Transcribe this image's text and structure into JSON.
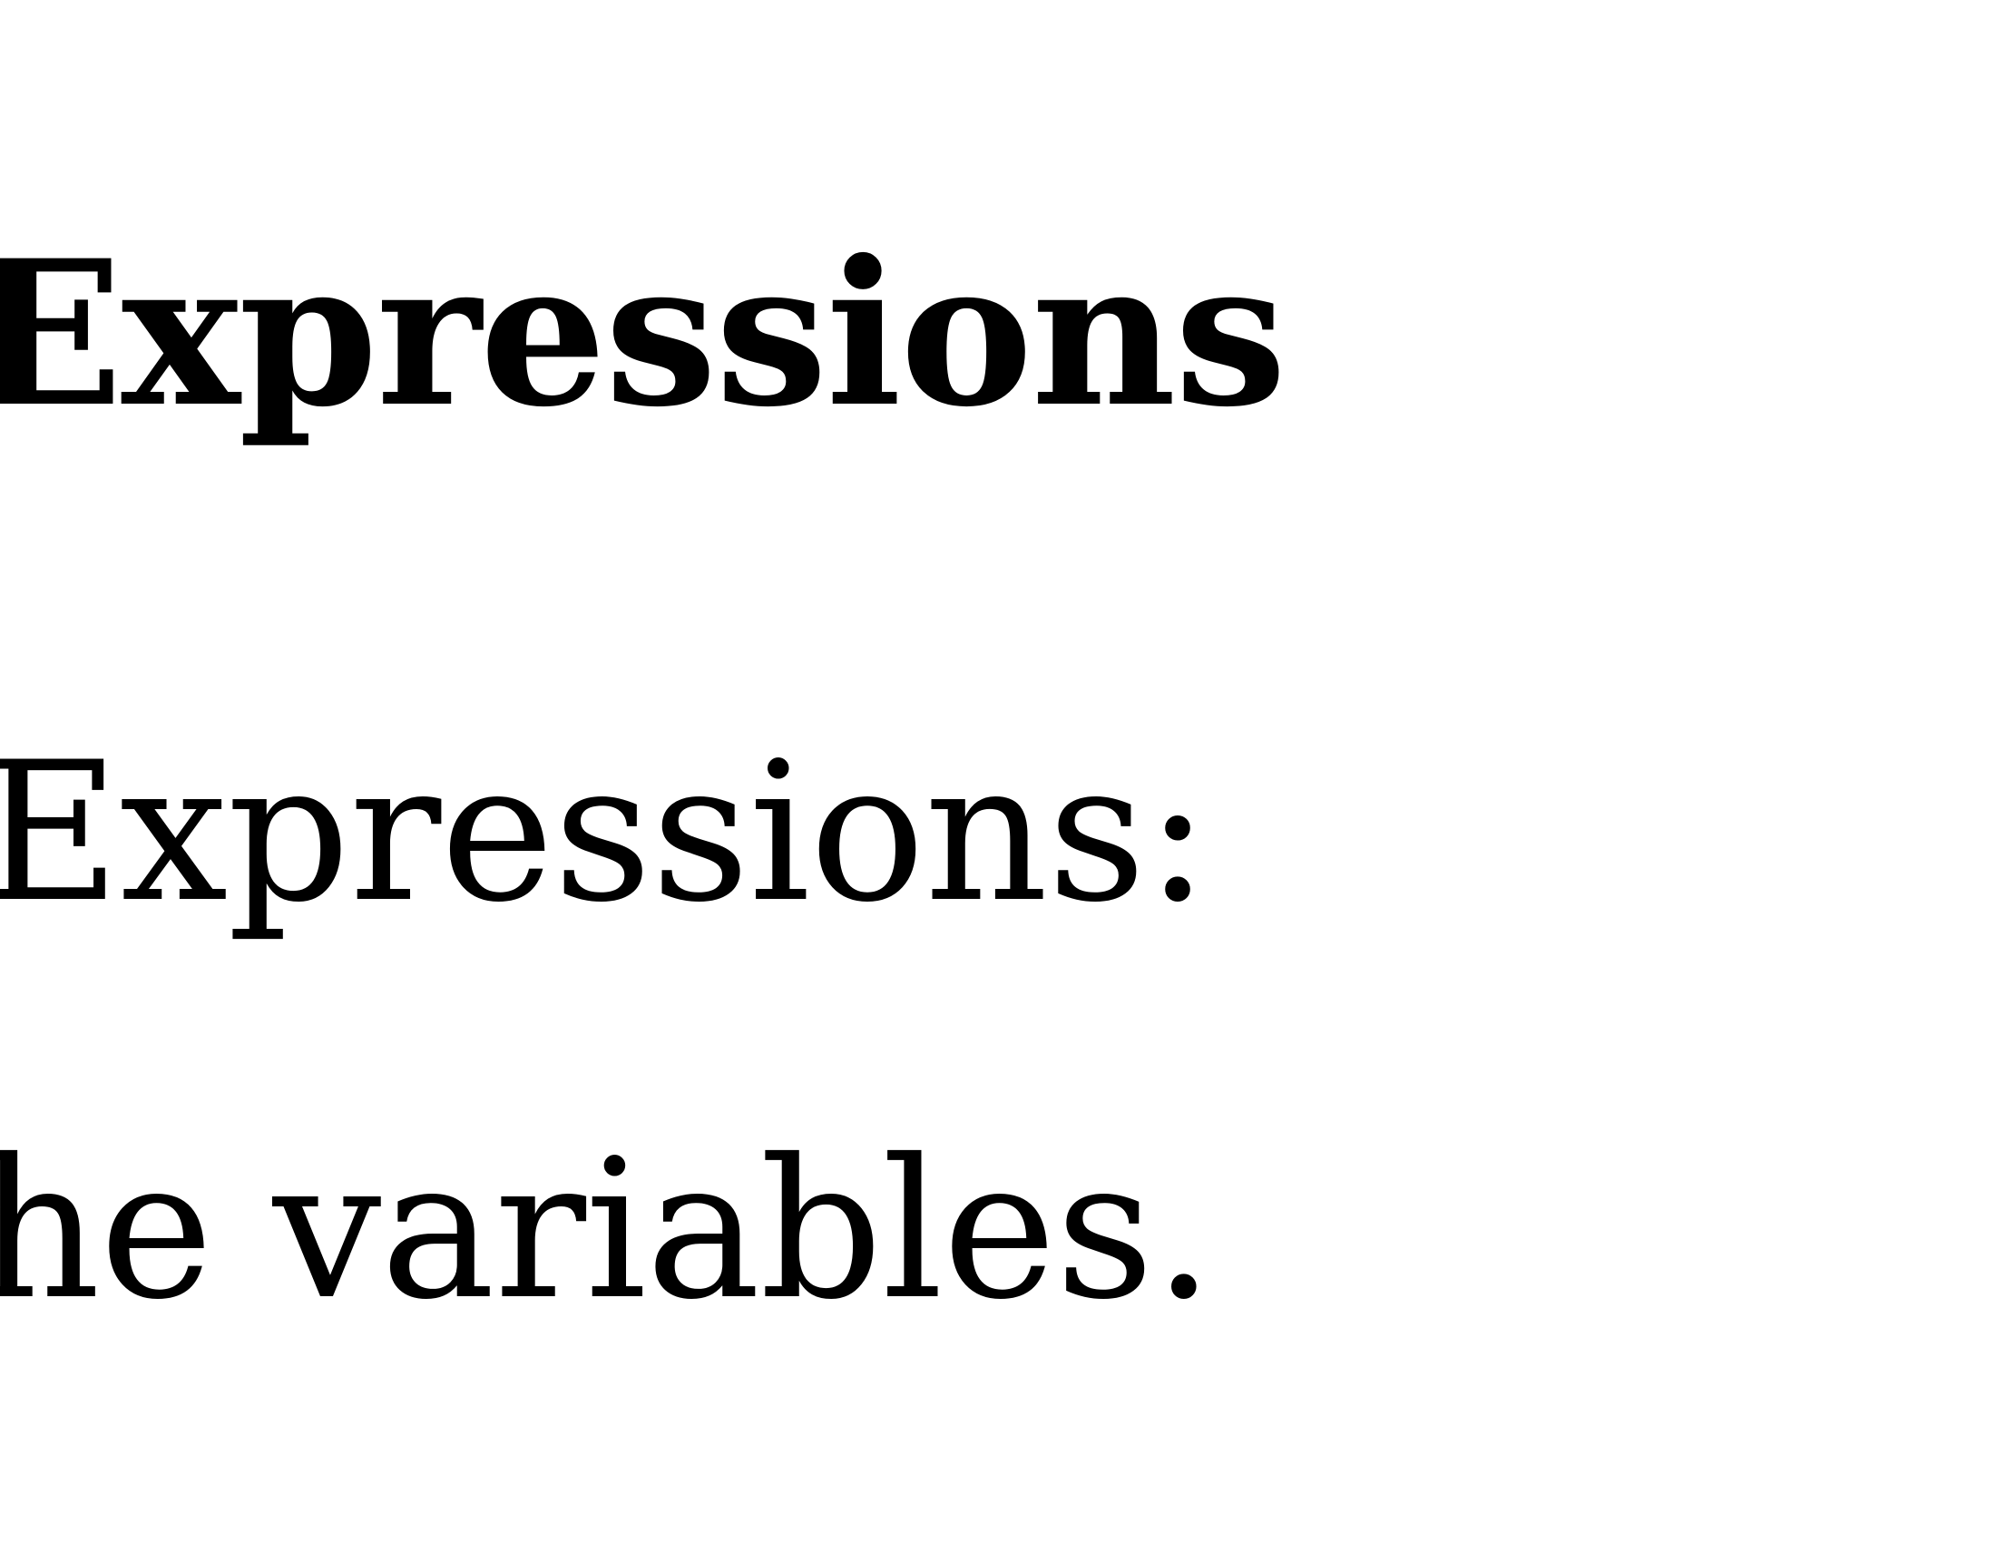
{
  "document": {
    "heading": "Expressions",
    "subheading": "Expressions:",
    "body_line": "the variables."
  }
}
